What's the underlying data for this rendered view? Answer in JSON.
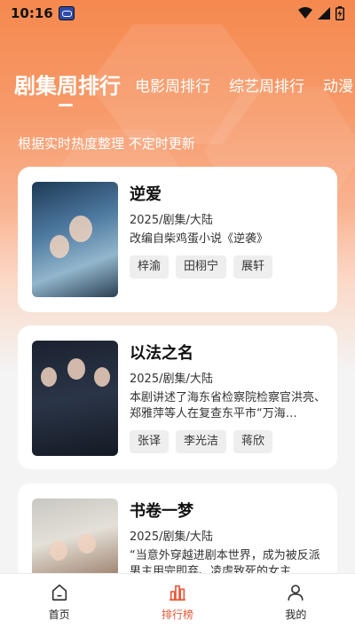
{
  "status_bar": {
    "time": "10:16"
  },
  "tabs": [
    {
      "label": "剧集周排行",
      "active": true
    },
    {
      "label": "电影周排行",
      "active": false
    },
    {
      "label": "综艺周排行",
      "active": false
    },
    {
      "label": "动漫",
      "active": false
    }
  ],
  "subtitle": "根据实时热度整理 不定时更新",
  "items": [
    {
      "title": "逆爱",
      "meta": "2025/剧集/大陆",
      "desc": "改编自柴鸡蛋小说《逆袭》",
      "tags": [
        "梓渝",
        "田栩宁",
        "展轩"
      ]
    },
    {
      "title": "以法之名",
      "meta": "2025/剧集/大陆",
      "desc": "本剧讲述了海东省检察院检察官洪亮、郑雅萍等人在复查东平市“万海…",
      "tags": [
        "张译",
        "李光洁",
        "蒋欣"
      ]
    },
    {
      "title": "书卷一梦",
      "meta": "2025/剧集/大陆",
      "desc": "“当意外穿越进剧本世界，成为被反派男主用完即弃、凌虐致死的女主",
      "tags": []
    }
  ],
  "bottom_nav": [
    {
      "label": "首页",
      "icon": "home-icon",
      "active": false
    },
    {
      "label": "排行榜",
      "icon": "ranking-icon",
      "active": true
    },
    {
      "label": "我的",
      "icon": "profile-icon",
      "active": false
    }
  ],
  "colors": {
    "accent": "#e85838",
    "header_gradient_top": "#f5894f"
  }
}
